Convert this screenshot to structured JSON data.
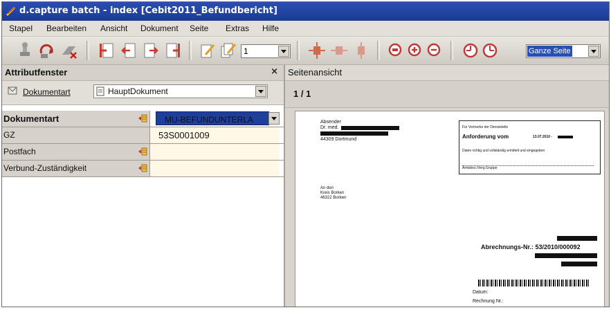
{
  "window": {
    "title": "d.capture batch - index [Cebit2011_Befundbericht]"
  },
  "menu": {
    "items": [
      "Stapel",
      "Bearbeiten",
      "Ansicht",
      "Dokument",
      "Seite",
      "Extras",
      "Hilfe"
    ]
  },
  "toolbar": {
    "page_select_value": "1",
    "zoom_select_value": "Ganze Seite",
    "icons": [
      "stamp-icon",
      "refresh-icon",
      "delete-icon",
      "first-page-icon",
      "prev-page-icon",
      "next-page-icon",
      "last-page-icon",
      "edit-icon",
      "edit-all-icon",
      "move-icon",
      "move-right-icon",
      "move-down-icon",
      "zoom-fit-icon",
      "zoom-in-icon",
      "zoom-out-icon",
      "rotate-left-icon",
      "rotate-right-icon"
    ]
  },
  "left_panel": {
    "title": "Attributfenster",
    "close": "×",
    "doc_type_label": "Dokumentart",
    "doc_type_value": "HauptDokument",
    "fields": [
      {
        "label": "Dokumentart",
        "value": "MU-BEFUNDUNTERLA",
        "selected": true,
        "has_list_icon": true
      },
      {
        "label": "GZ",
        "value": "53S0001009",
        "has_list_icon": false
      },
      {
        "label": "Postfach",
        "value": "",
        "has_list_icon": true
      },
      {
        "label": "Verbund-Zuständigkeit",
        "value": "",
        "has_list_icon": true
      }
    ]
  },
  "right_panel": {
    "title": "Seitenansicht",
    "page_indicator": "1 / 1",
    "document": {
      "sender_label": "Absender",
      "sender_name": "Dr. med.",
      "sender_city": "44309 Dortmund",
      "recipient_1": "An den",
      "recipient_2": "Kreis Borken",
      "recipient_3": "46322 Borken",
      "box_line_1": "Für Vermerke der Dienststelle",
      "box_line_2": "Anforderung vom",
      "box_date": "13.07.2010 -",
      "box_line_3": "Daten richtig und vollständig ermittelt und eingegeben",
      "box_line_4": "Amtsbez./Verg.Gruppe",
      "invoice": "Abrechnungs-Nr.: 53/2010/000092",
      "datum_label": "Datum:",
      "rechnung_label": "Rechnung Nr.:"
    }
  }
}
